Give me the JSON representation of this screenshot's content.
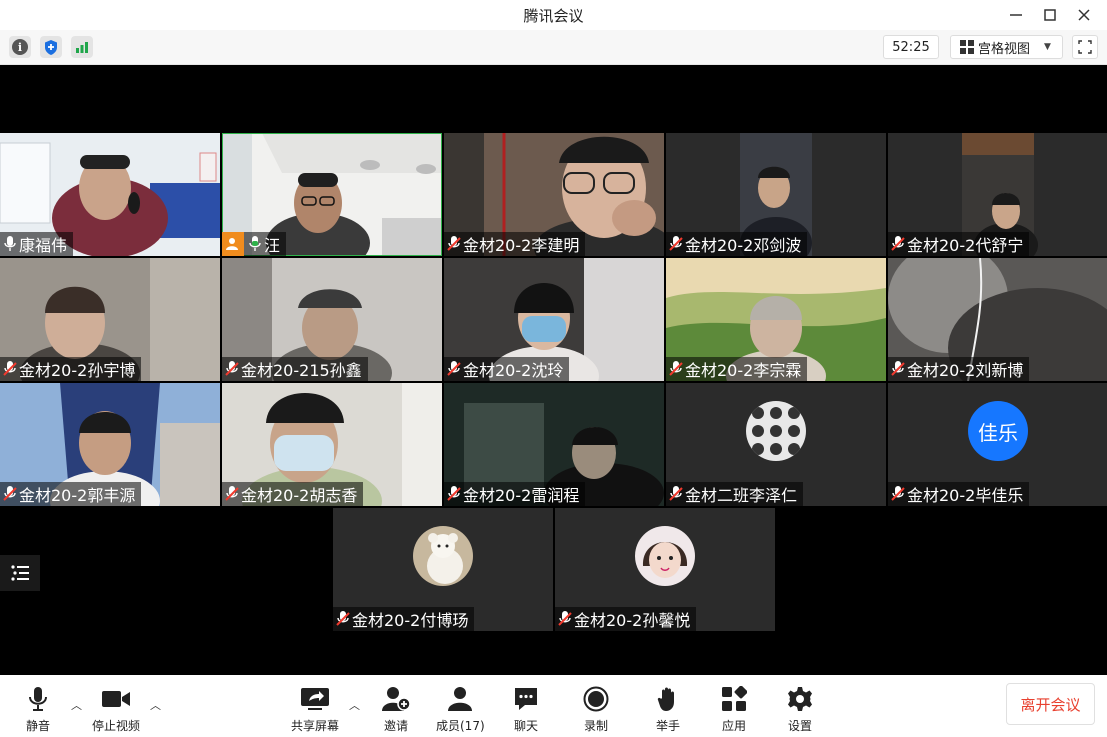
{
  "window": {
    "title": "腾讯会议"
  },
  "topbar": {
    "timer": "52:25",
    "view_label": "宫格视图"
  },
  "tiles_row1": [
    {
      "name": "康福伟",
      "muted": false,
      "colors": [
        "#e9eef2",
        "#2c4fa8",
        "#c9a38a"
      ]
    },
    {
      "name": "汪",
      "muted": false,
      "colors": [
        "#f1f1ef",
        "#cfcfcf",
        "#b0856a"
      ]
    },
    {
      "name": "金材20-2李建明",
      "muted": true,
      "colors": [
        "#6c5a4e",
        "#2b2b2b",
        "#d7b39c"
      ]
    },
    {
      "name": "金材20-2邓剑波",
      "muted": true,
      "colors": [
        "#3a3d44",
        "#1d1f26",
        "#c8a488"
      ]
    },
    {
      "name": "金材20-2代舒宁",
      "muted": true,
      "colors": [
        "#3a3836",
        "#1a1a1a",
        "#c9a58a"
      ]
    }
  ],
  "tiles_row2": [
    {
      "name": "金材20-2孙宇博",
      "muted": true,
      "colors": [
        "#9a948c",
        "#4a4642",
        "#cfae98"
      ]
    },
    {
      "name": "金材20-215孙鑫",
      "muted": true,
      "colors": [
        "#c9c6c2",
        "#6a6864",
        "#b99b85"
      ]
    },
    {
      "name": "金材20-2沈玲",
      "muted": true,
      "colors": [
        "#3d3b3a",
        "#d8d6d6",
        "#7ab6dc"
      ]
    },
    {
      "name": "金材20-2李宗霖",
      "muted": true,
      "colors": [
        "#a8b86e",
        "#5d8a3a",
        "#d8cfc2"
      ]
    },
    {
      "name": "金材20-2刘新博",
      "muted": true,
      "colors": [
        "#5a5856",
        "#3c3a39",
        "#8d8b88"
      ]
    }
  ],
  "tiles_row3": [
    {
      "name": "金材20-2郭丰源",
      "muted": true,
      "colors": [
        "#2a3f7a",
        "#8fb0d8",
        "#c59d82"
      ]
    },
    {
      "name": "金材20-2胡志香",
      "muted": true,
      "colors": [
        "#dcdad4",
        "#cfe3ef",
        "#c8a48a"
      ]
    },
    {
      "name": "金材20-2雷润程",
      "muted": true,
      "colors": [
        "#1e2a26",
        "#3d4b45",
        "#9a8c7c"
      ]
    },
    {
      "name": "金材二班李泽仁",
      "muted": true,
      "avatar": "photo"
    },
    {
      "name": "金材20-2毕佳乐",
      "muted": true,
      "avatar": "text",
      "avatar_text": "佳乐",
      "avatar_color": "#1677ff"
    }
  ],
  "tiles_row4": [
    {
      "name": "金材20-2付博玚",
      "muted": true,
      "avatar": "photo"
    },
    {
      "name": "金材20-2孙馨悦",
      "muted": true,
      "avatar": "photo"
    }
  ],
  "toolbar": {
    "mute": "静音",
    "stop_video": "停止视频",
    "share": "共享屏幕",
    "invite": "邀请",
    "members": "成员(17)",
    "chat": "聊天",
    "record": "录制",
    "raise_hand": "举手",
    "apps": "应用",
    "settings": "设置",
    "leave": "离开会议"
  },
  "icons": {
    "info": "info-icon",
    "security": "shield-icon",
    "signal": "signal-icon",
    "grid": "grid-view-icon",
    "fullscreen": "fullscreen-icon",
    "mic_muted": "mic-muted-icon"
  },
  "colors": {
    "leave_text": "#e8402f",
    "host_badge": "#f08c1e",
    "active_border": "#2fb24a",
    "signal": "#1fa64a"
  }
}
